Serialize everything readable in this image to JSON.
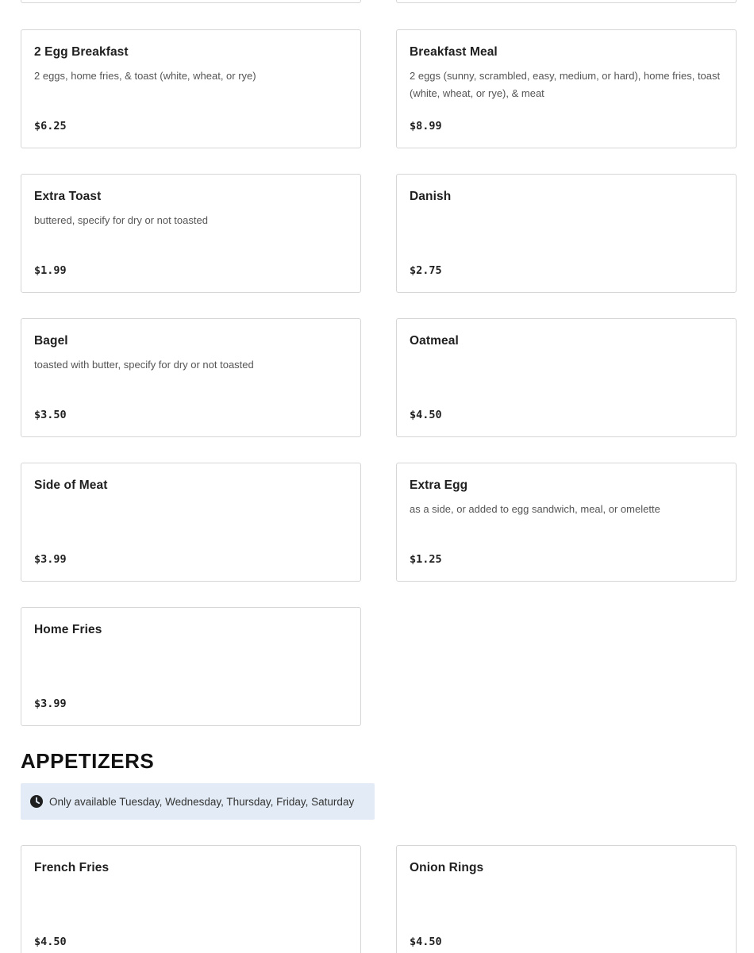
{
  "breakfast_items": [
    {
      "name": "2 Egg Breakfast",
      "description": "2 eggs, home fries, & toast (white, wheat, or rye)",
      "price": "$6.25"
    },
    {
      "name": "Breakfast Meal",
      "description": "2 eggs (sunny, scrambled, easy, medium, or hard), home fries, toast (white, wheat, or rye), & meat",
      "price": "$8.99"
    },
    {
      "name": "Extra Toast",
      "description": "buttered, specify for dry or not toasted",
      "price": "$1.99"
    },
    {
      "name": "Danish",
      "description": "",
      "price": "$2.75"
    },
    {
      "name": "Bagel",
      "description": "toasted with butter, specify for dry or not toasted",
      "price": "$3.50"
    },
    {
      "name": "Oatmeal",
      "description": "",
      "price": "$4.50"
    },
    {
      "name": "Side of Meat",
      "description": "",
      "price": "$3.99"
    },
    {
      "name": "Extra Egg",
      "description": "as a side, or added to egg sandwich, meal, or omelette",
      "price": "$1.25"
    },
    {
      "name": "Home Fries",
      "description": "",
      "price": "$3.99"
    }
  ],
  "appetizers": {
    "title": "APPETIZERS",
    "availability_icon": "clock-icon",
    "availability_text": "Only available Tuesday, Wednesday, Thursday, Friday, Saturday",
    "items": [
      {
        "name": "French Fries",
        "description": "",
        "price": "$4.50"
      },
      {
        "name": "Onion Rings",
        "description": "",
        "price": "$4.50"
      }
    ]
  },
  "colors": {
    "card_border": "#d6d6d6",
    "availability_bg": "#e3ecf6",
    "text_primary": "#1f1f1f",
    "text_secondary": "#555555"
  }
}
